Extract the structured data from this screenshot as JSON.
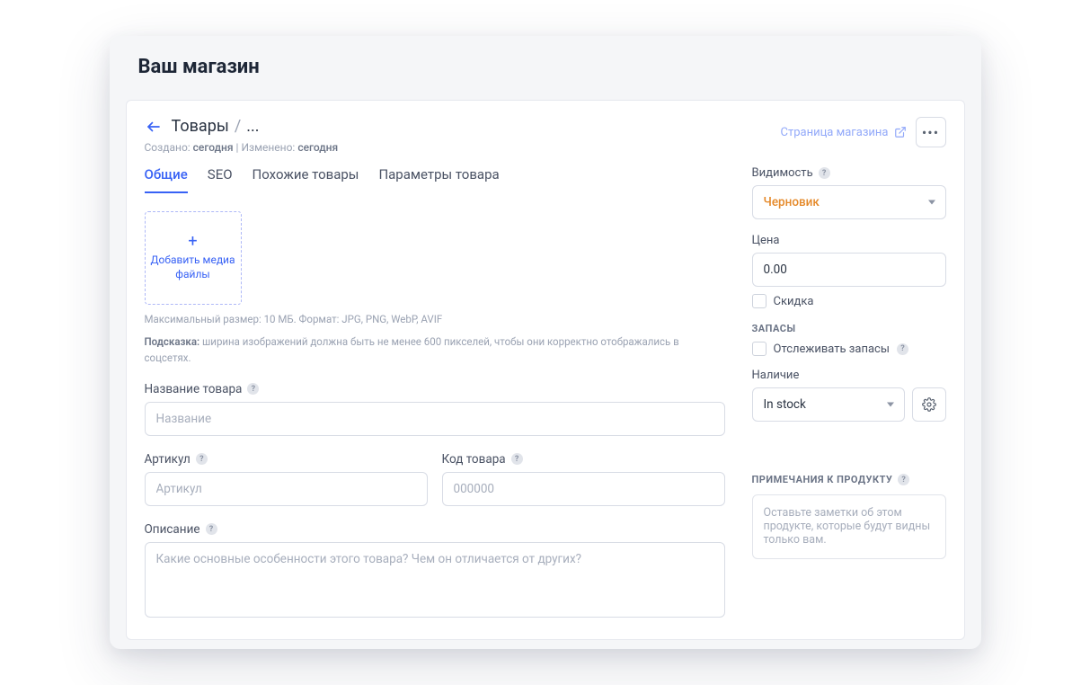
{
  "app": {
    "title": "Ваш магазин"
  },
  "header": {
    "breadcrumb_root": "Товары",
    "breadcrumb_current": "...",
    "created_label": "Создано:",
    "created_value": "сегодня",
    "modified_label": "Изменено:",
    "modified_value": "сегодня",
    "store_link": "Страница магазина"
  },
  "tabs": {
    "general": "Общие",
    "seo": "SEO",
    "related": "Похожие товары",
    "params": "Параметры товара"
  },
  "media": {
    "add_label": "Добавить медиа файлы",
    "size_hint": "Максимальный размер: 10 МБ. Формат: JPG, PNG, WebP, AVIF",
    "tip_label": "Подсказка:",
    "tip_text": "ширина изображений должна быть не менее 600 пикселей, чтобы они корректно отображались в соцсетях."
  },
  "fields": {
    "name_label": "Название товара",
    "name_placeholder": "Название",
    "sku_label": "Артикул",
    "sku_placeholder": "Артикул",
    "code_label": "Код товара",
    "code_placeholder": "000000",
    "desc_label": "Описание",
    "desc_placeholder": "Какие основные особенности этого товара? Чем он отличается от других?"
  },
  "sidebar": {
    "visibility_label": "Видимость",
    "visibility_value": "Черновик",
    "price_label": "Цена",
    "price_value": "0.00",
    "discount_label": "Скидка",
    "stock_heading": "ЗАПАСЫ",
    "track_label": "Отслеживать запасы",
    "availability_label": "Наличие",
    "availability_value": "In stock"
  },
  "notes": {
    "heading": "ПРИМЕЧАНИЯ К ПРОДУКТУ",
    "placeholder": "Оставьте заметки об этом продукте, которые будут видны только вам."
  }
}
